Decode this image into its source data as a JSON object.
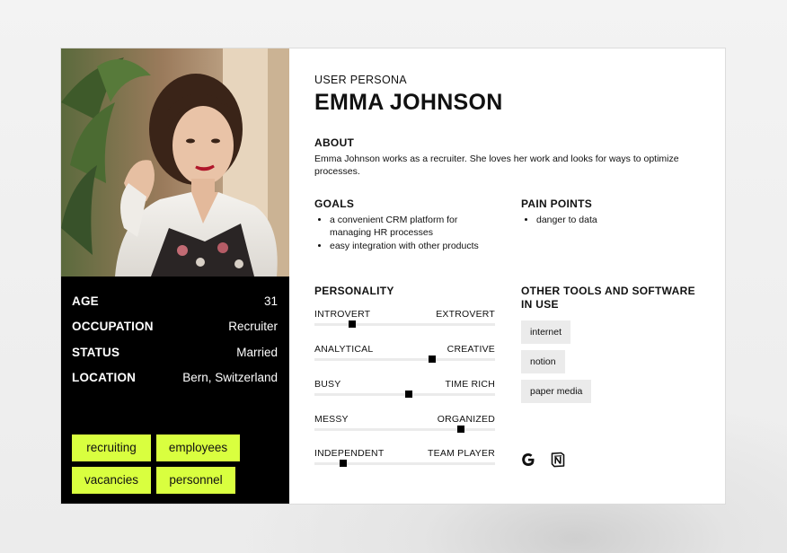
{
  "header": {
    "subtitle": "USER PERSONA",
    "name": "EMMA JOHNSON"
  },
  "about": {
    "heading": "ABOUT",
    "text": "Emma Johnson works as a recruiter. She loves her work and looks for ways to optimize processes."
  },
  "goals": {
    "heading": "GOALS",
    "items": [
      "a convenient CRM platform for managing HR processes",
      "easy integration with other products"
    ]
  },
  "pain_points": {
    "heading": "PAIN POINTS",
    "items": [
      "danger to data"
    ]
  },
  "info": [
    {
      "label": "AGE",
      "value": "31"
    },
    {
      "label": "OCCUPATION",
      "value": "Recruiter"
    },
    {
      "label": "STATUS",
      "value": "Married"
    },
    {
      "label": "LOCATION",
      "value": "Bern, Switzerland"
    }
  ],
  "tags": [
    "recruiting",
    "employees",
    "vacancies",
    "personnel"
  ],
  "personality": {
    "heading": "PERSONALITY",
    "traits": [
      {
        "left": "INTROVERT",
        "right": "EXTROVERT",
        "level": 0.21
      },
      {
        "left": "ANALYTICAL",
        "right": "CREATIVE",
        "level": 0.65
      },
      {
        "left": "BUSY",
        "right": "TIME RICH",
        "level": 0.52
      },
      {
        "left": "MESSY",
        "right": "ORGANIZED",
        "level": 0.81
      },
      {
        "left": "INDEPENDENT",
        "right": "TEAM PLAYER",
        "level": 0.16
      }
    ]
  },
  "tools": {
    "heading": "OTHER TOOLS AND SOFTWARE IN USE",
    "items": [
      "internet",
      "notion",
      "paper media"
    ],
    "logos": [
      "google-logo",
      "notion-logo"
    ]
  },
  "colors": {
    "tag_bg": "#d9ff3f",
    "panel_bg": "#000000",
    "chip_bg": "#ebebeb"
  }
}
